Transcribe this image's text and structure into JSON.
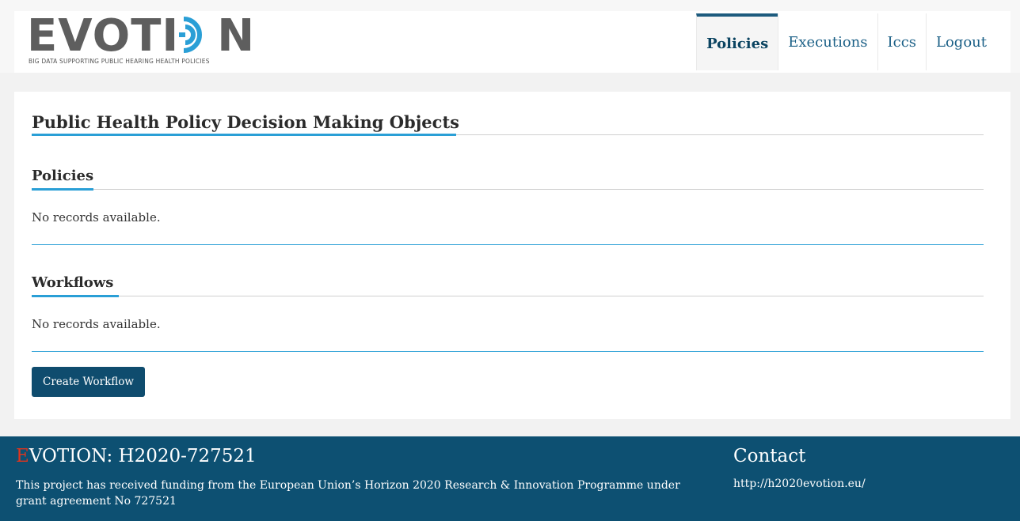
{
  "logo": {
    "wordmark_left": "EVOTI",
    "wordmark_right": "N",
    "tagline": "BIG DATA SUPPORTING PUBLIC HEARING HEALTH POLICIES",
    "icon": "concentric-rings-icon"
  },
  "nav": {
    "items": [
      {
        "label": "Policies",
        "active": true
      },
      {
        "label": "Executions",
        "active": false
      },
      {
        "label": "Iccs",
        "active": false
      },
      {
        "label": "Logout",
        "active": false
      }
    ]
  },
  "main": {
    "page_title": "Public Health Policy Decision Making Objects",
    "sections": [
      {
        "title": "Policies",
        "empty_text": "No records available."
      },
      {
        "title": "Workflows",
        "empty_text": "No records available."
      }
    ],
    "create_button": "Create Workflow"
  },
  "footer": {
    "title_first_letter": "E",
    "title_rest": "VOTION: H2020-727521",
    "funding_text": "This project has received funding from the European Union’s Horizon 2020 Research & Innovation Programme under grant agreement No 727521",
    "contact_title": "Contact",
    "contact_link": "http://h2020evotion.eu/"
  },
  "colors": {
    "accent_blue": "#2a9fd6",
    "footer_bg": "#0d5072",
    "button_bg": "#0f4c6e",
    "logo_red": "#e2341d"
  }
}
